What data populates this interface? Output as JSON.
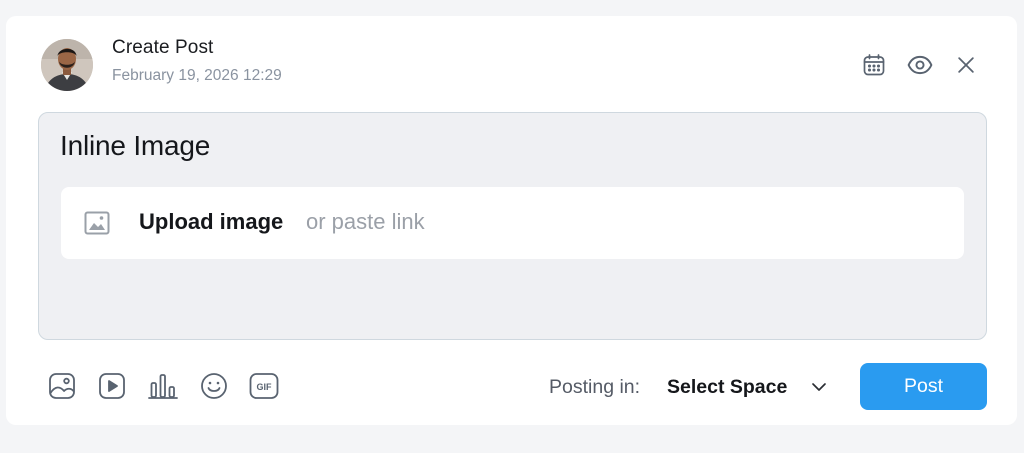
{
  "header": {
    "title": "Create Post",
    "timestamp": "February 19, 2026 12:29",
    "actions": [
      {
        "name": "schedule",
        "icon": "calendar-icon"
      },
      {
        "name": "preview",
        "icon": "eye-icon"
      },
      {
        "name": "close",
        "icon": "close-icon"
      }
    ]
  },
  "editor": {
    "heading": "Inline Image",
    "upload": {
      "label": "Upload image",
      "hint": "or paste link",
      "icon": "image-placeholder-icon"
    }
  },
  "toolbar": {
    "tools": [
      {
        "name": "add-image",
        "icon": "image-icon"
      },
      {
        "name": "add-video",
        "icon": "video-play-icon"
      },
      {
        "name": "add-poll",
        "icon": "bar-chart-icon"
      },
      {
        "name": "add-emoji",
        "icon": "smiley-icon"
      },
      {
        "name": "add-gif",
        "icon": "gif-icon",
        "text": "GIF"
      }
    ],
    "posting_label": "Posting in:",
    "space_value": "Select Space",
    "post_button": "Post"
  },
  "colors": {
    "accent": "#2a9bf0",
    "editor_bg": "#eff0f3",
    "editor_border": "#cfd8df",
    "muted_text": "#8a93a0",
    "icon": "#596370"
  }
}
